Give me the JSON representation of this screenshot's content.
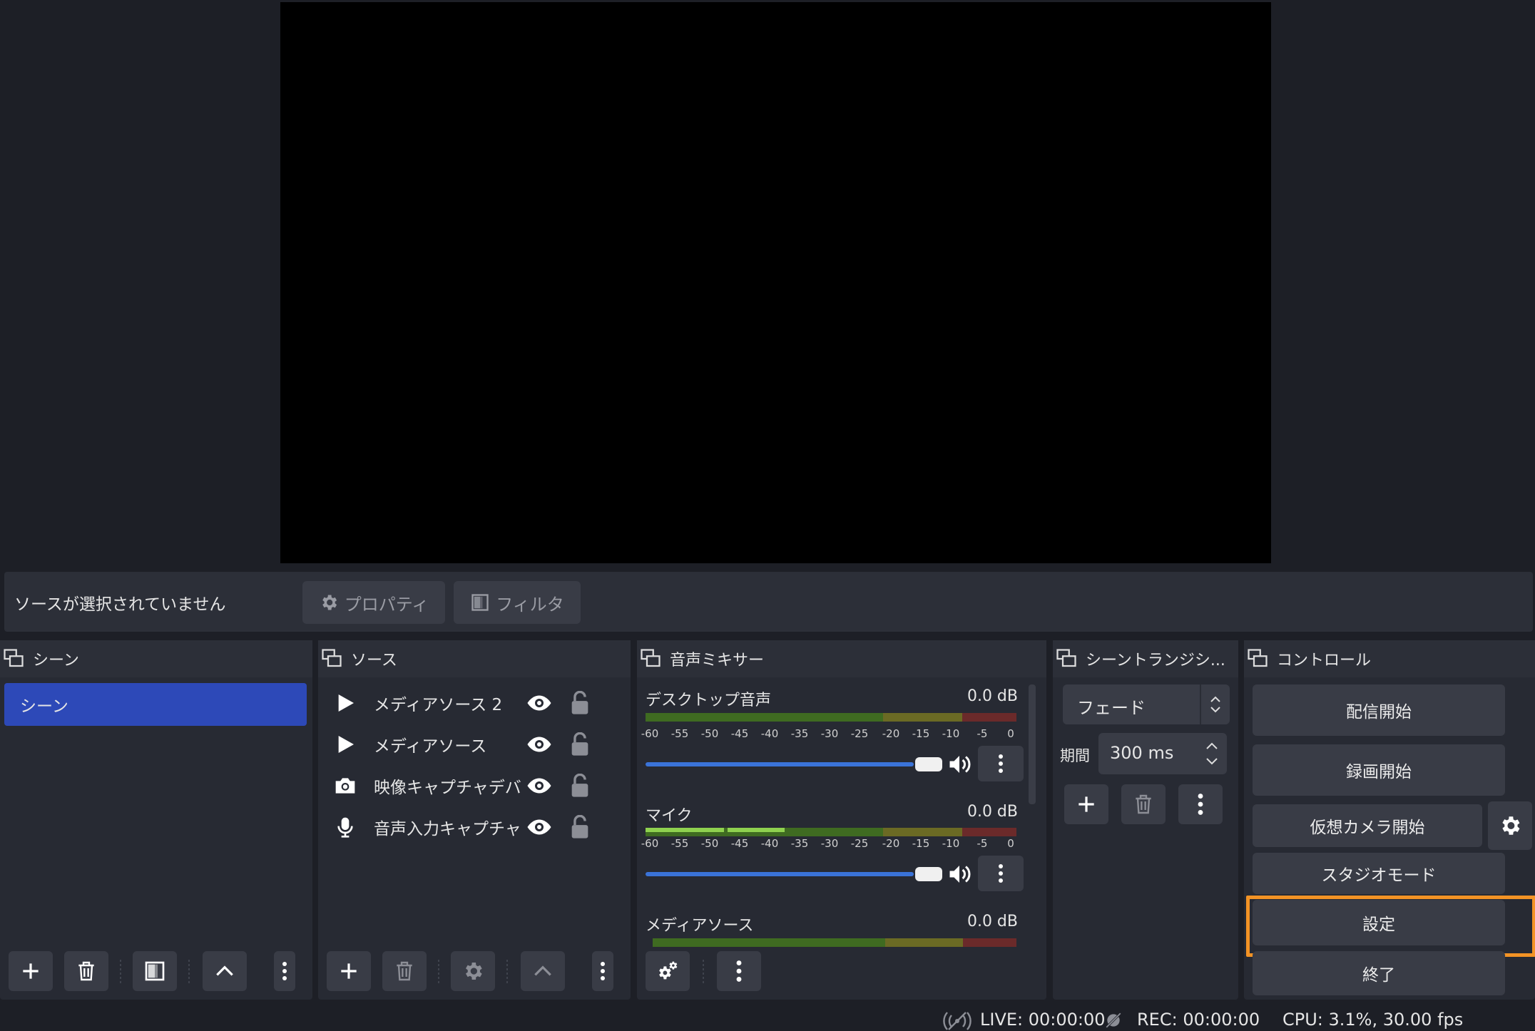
{
  "context_bar": {
    "no_source_label": "ソースが選択されていません",
    "properties_label": "プロパティ",
    "filters_label": "フィルタ"
  },
  "scenes": {
    "title": "シーン",
    "items": [
      {
        "label": "シーン",
        "selected": true
      }
    ]
  },
  "sources": {
    "title": "ソース",
    "items": [
      {
        "label": "メディアソース 2",
        "type_icon": "play-icon"
      },
      {
        "label": "メディアソース",
        "type_icon": "play-icon"
      },
      {
        "label": "映像キャプチャデバ",
        "type_icon": "camera-icon"
      },
      {
        "label": "音声入力キャプチャ",
        "type_icon": "microphone-icon"
      }
    ]
  },
  "mixer": {
    "title": "音声ミキサー",
    "scale": [
      "-60",
      "-55",
      "-50",
      "-45",
      "-40",
      "-35",
      "-30",
      "-25",
      "-20",
      "-15",
      "-10",
      "-5",
      "0"
    ],
    "channels": [
      {
        "name": "デスクトップ音声",
        "db": "0.0 dB",
        "volume": 1.0
      },
      {
        "name": "マイク",
        "db": "0.0 dB",
        "volume": 1.0
      },
      {
        "name": "メディアソース",
        "db": "0.0 dB",
        "volume": 1.0
      }
    ]
  },
  "transitions": {
    "title": "シーントランジシ...",
    "selected": "フェード",
    "duration_label": "期間",
    "duration_value": "300 ms"
  },
  "controls": {
    "title": "コントロール",
    "start_streaming": "配信開始",
    "start_recording": "録画開始",
    "start_virtual_camera": "仮想カメラ開始",
    "studio_mode": "スタジオモード",
    "settings": "設定",
    "exit": "終了"
  },
  "status": {
    "live": "LIVE: 00:00:00",
    "rec": "REC: 00:00:00",
    "cpu": "CPU: 3.1%, 30.00 fps"
  },
  "colors": {
    "accent_selection": "#2d49b8",
    "highlight": "#f39325",
    "slider": "#3a73d8"
  }
}
